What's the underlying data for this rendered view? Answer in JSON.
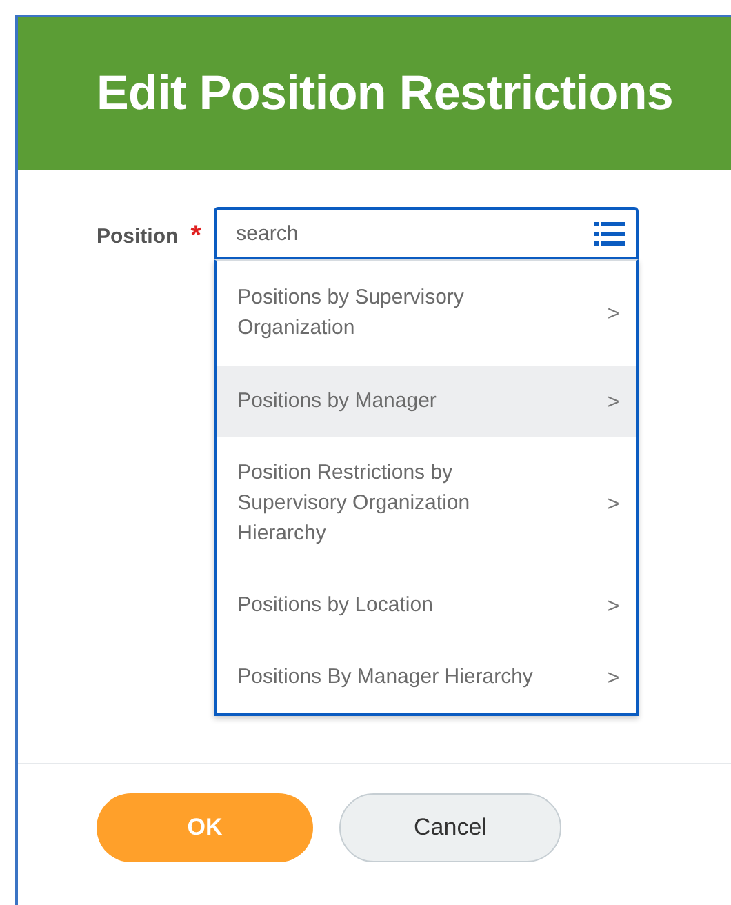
{
  "header": {
    "title": "Edit Position Restrictions"
  },
  "field": {
    "label": "Position",
    "required_mark": "*",
    "placeholder": "search"
  },
  "menu": [
    {
      "label": "Positions by Supervisory Organization",
      "selected": false,
      "chevron": ">"
    },
    {
      "label": "Positions by Manager",
      "selected": true,
      "chevron": ">"
    },
    {
      "label": "Position Restrictions by Supervisory Organization Hierarchy",
      "selected": false,
      "chevron": ">"
    },
    {
      "label": "Positions by Location",
      "selected": false,
      "chevron": ">"
    },
    {
      "label": "Positions By Manager Hierarchy",
      "selected": false,
      "chevron": ">"
    }
  ],
  "buttons": [
    {
      "label": "OK",
      "kind": "primary"
    },
    {
      "label": "Cancel",
      "kind": "secondary"
    }
  ]
}
